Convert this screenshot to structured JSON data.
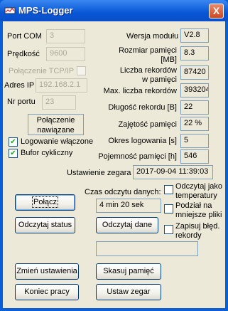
{
  "window": {
    "title": "MPS-Logger",
    "close": "X"
  },
  "connection": {
    "port_label": "Port COM",
    "port_value": "3",
    "speed_label": "Prędkość",
    "speed_value": "9600",
    "tcp_label": "Połączenie TCP/IP",
    "tcp_checked": false,
    "ip_label": "Adres IP",
    "ip_value": "192.168.2.1",
    "portnr_label": "Nr portu",
    "portnr_value": "23",
    "status_line1": "Połączenie",
    "status_line2": "nawiązane"
  },
  "options": {
    "log_on_label": "Logowanie włączone",
    "log_on_checked": true,
    "cyclic_label": "Bufor cykliczny",
    "cyclic_checked": true
  },
  "info": {
    "version_label": "Wersja modułu",
    "version_value": "V2.8",
    "memsize_label1": "Rozmiar pamięci",
    "memsize_label2": "[MB]",
    "memsize_value": "8.3",
    "records_label1": "Liczba rekordów",
    "records_label2": "w pamięci",
    "records_value": "87420",
    "maxrec_label": "Max. liczba rekordów",
    "maxrec_value": "393204",
    "reclen_label": "Długość rekordu [B]",
    "reclen_value": "22",
    "used_label": "Zajętość pamięci",
    "used_value": "22 %",
    "period_label": "Okres logowania [s]",
    "period_value": "5",
    "capacity_label": "Pojemność pamięci [h]",
    "capacity_value": "546",
    "clock_label": "Ustawienie zegara",
    "clock_value": "2017-09-04 11:39:03"
  },
  "read": {
    "time_label": "Czas odczytu danych:",
    "time_value": "4 min 20 sek",
    "opt_temp_line1": "Odczytaj jako",
    "opt_temp_line2": "temperatury",
    "opt_temp_checked": false,
    "opt_split_line1": "Podział na",
    "opt_split_line2": "mniejsze pliki",
    "opt_split_checked": false,
    "opt_err_line1": "Zapisuj błęd.",
    "opt_err_line2": "rekordy",
    "opt_err_checked": false,
    "progress_percent": 0
  },
  "buttons": {
    "connect": "Połącz",
    "read_status": "Odczytaj status",
    "read_data": "Odczytaj dane",
    "change_settings": "Zmień ustawienia",
    "erase_memory": "Skasuj pamięć",
    "end_work": "Koniec pracy",
    "set_clock": "Ustaw zegar"
  }
}
